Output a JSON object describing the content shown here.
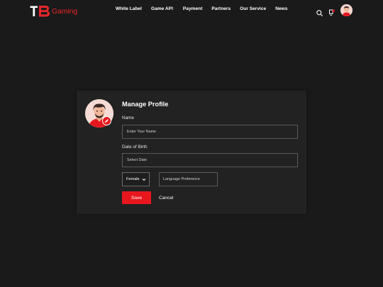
{
  "brand": {
    "mark": "TB",
    "name": "Gaming",
    "color": "#e8262c"
  },
  "nav": {
    "items": [
      "White Label",
      "Game API",
      "Payment",
      "Partners",
      "Our Service",
      "News"
    ]
  },
  "header_icons": [
    "search-icon",
    "notification-bell-icon",
    "user-avatar"
  ],
  "profile_form": {
    "title": "Manage Profile",
    "name_label": "Name",
    "name_placeholder": "Enter Your Name",
    "dob_label": "Date of Birth",
    "dob_placeholder": "Select Date",
    "gender_selected": "Female",
    "language_placeholder": "Language Preference",
    "save_label": "Save",
    "cancel_label": "Cancel"
  },
  "colors": {
    "background": "#1a1a1a",
    "card": "#222222",
    "accent": "#e8171d"
  }
}
